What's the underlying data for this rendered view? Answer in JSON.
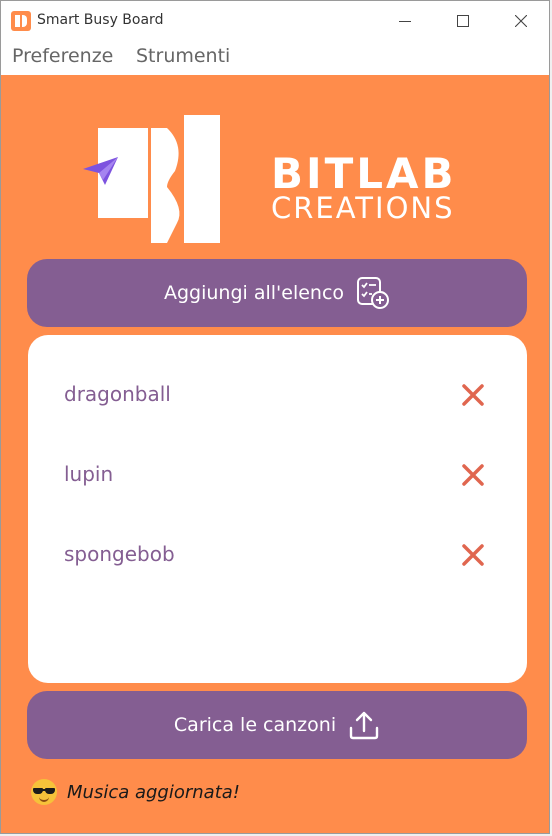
{
  "window": {
    "title": "Smart Busy Board"
  },
  "menu": {
    "items": [
      "Preferenze",
      "Strumenti"
    ]
  },
  "logo": {
    "line1": "BITLAB",
    "line2": "CREATIONS"
  },
  "actions": {
    "add_label": "Aggiungi all'elenco",
    "add_icon": "checklist-add-icon",
    "upload_label": "Carica le canzoni",
    "upload_icon": "upload-icon"
  },
  "list": {
    "items": [
      {
        "label": "dragonball",
        "delete_icon": "close-icon"
      },
      {
        "label": "lupin",
        "delete_icon": "close-icon"
      },
      {
        "label": "spongebob",
        "delete_icon": "close-icon"
      }
    ]
  },
  "status": {
    "icon": "sunglasses-emoji-icon",
    "text": "Musica aggiornata!"
  },
  "colors": {
    "background": "#ff8c4b",
    "button": "#845e92",
    "delete": "#e0664f",
    "list_text": "#845e92"
  }
}
